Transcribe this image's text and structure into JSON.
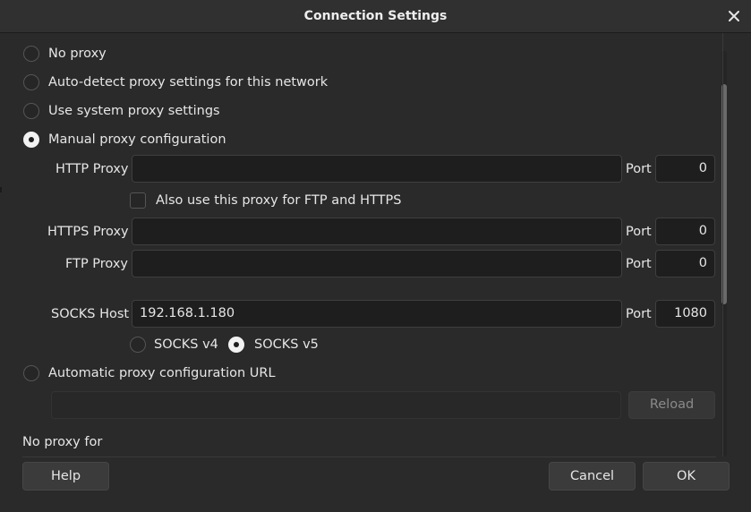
{
  "dialog": {
    "title": "Connection Settings",
    "close_icon": "close-icon"
  },
  "proxy_options": {
    "no_proxy": "No proxy",
    "auto_detect": "Auto-detect proxy settings for this network",
    "system": "Use system proxy settings",
    "manual": "Manual proxy configuration",
    "selected": "manual"
  },
  "http": {
    "label": "HTTP Proxy",
    "value": "",
    "port_label": "Port",
    "port": "0",
    "also_use_label": "Also use this proxy for FTP and HTTPS",
    "also_use_checked": false
  },
  "https": {
    "label": "HTTPS Proxy",
    "value": "",
    "port_label": "Port",
    "port": "0"
  },
  "ftp": {
    "label": "FTP Proxy",
    "value": "",
    "port_label": "Port",
    "port": "0"
  },
  "socks": {
    "label": "SOCKS Host",
    "value": "192.168.1.180",
    "port_label": "Port",
    "port": "1080",
    "v4_label": "SOCKS v4",
    "v5_label": "SOCKS v5",
    "selected_version": "v5"
  },
  "auto_config": {
    "label": "Automatic proxy configuration URL",
    "value": "",
    "reload_label": "Reload"
  },
  "no_proxy_for": {
    "label": "No proxy for"
  },
  "buttons": {
    "help": "Help",
    "cancel": "Cancel",
    "ok": "OK"
  },
  "colors": {
    "background": "#2a2a2a",
    "field": "#1e1e1e",
    "button": "#3b3b3b",
    "text": "#e6e6e6"
  }
}
